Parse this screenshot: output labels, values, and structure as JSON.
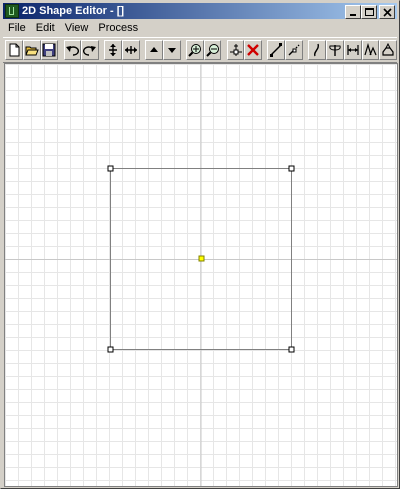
{
  "window": {
    "title": "2D Shape Editor - []"
  },
  "menu": {
    "items": [
      "File",
      "Edit",
      "View",
      "Process"
    ]
  },
  "toolbar": {
    "buttons": [
      "new-icon",
      "open-icon",
      "save-icon",
      "undo-icon",
      "redo-icon",
      "move-vertical-icon",
      "move-horizontal-icon",
      "arrow-up-icon",
      "arrow-down-icon",
      "zoom-in-icon",
      "zoom-out-icon",
      "add-point-icon",
      "delete-icon",
      "line-icon",
      "split-icon",
      "bezier-icon",
      "flip-icon",
      "width-icon",
      "extrude-icon",
      "revolve-icon"
    ]
  },
  "colors": {
    "title_start": "#0a246a",
    "title_end": "#a6caf0",
    "origin_marker": "#ffff00"
  }
}
